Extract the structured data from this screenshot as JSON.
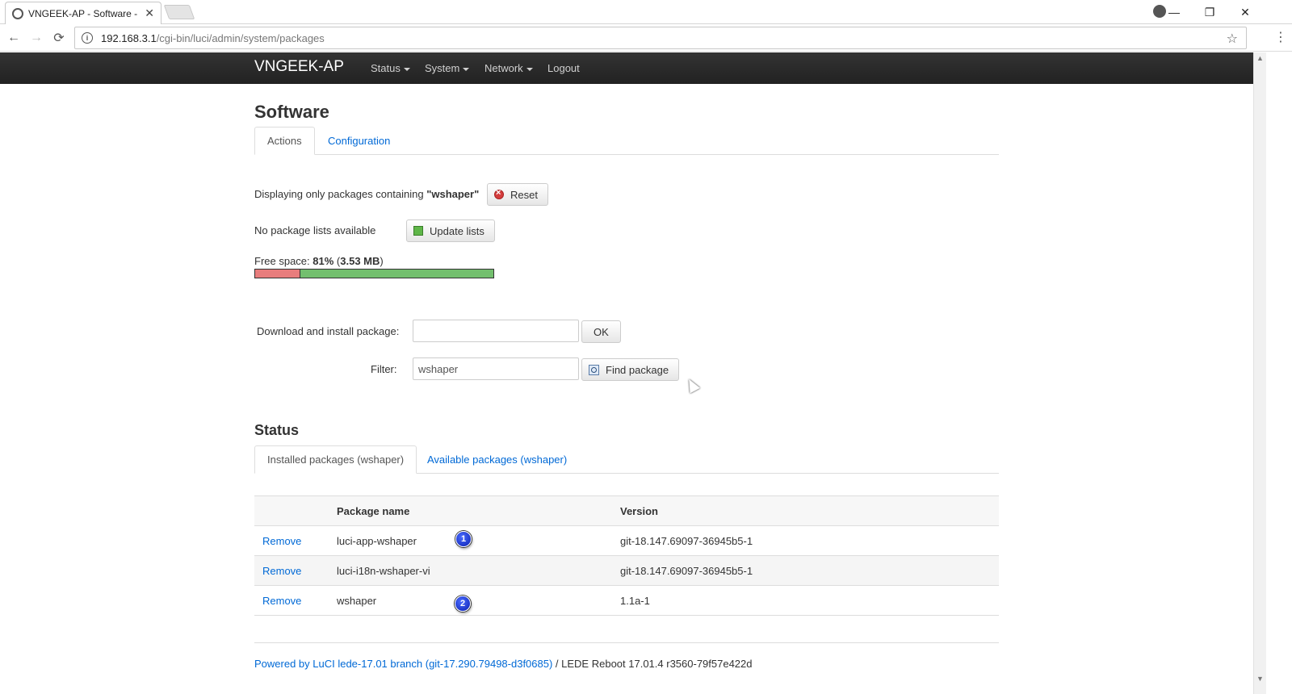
{
  "browser": {
    "tab_title": "VNGEEK-AP - Software -",
    "tab_close": "✕",
    "url_host": "192.168.3.1",
    "url_path": "/cgi-bin/luci/admin/system/packages",
    "back": "←",
    "forward": "→",
    "reload": "⟳",
    "star": "☆",
    "menu": "⋮",
    "minimize": "—",
    "restore": "❐",
    "close": "✕"
  },
  "navbar": {
    "brand": "VNGEEK-AP",
    "items": [
      "Status",
      "System",
      "Network",
      "Logout"
    ]
  },
  "page": {
    "title": "Software",
    "tabs": [
      "Actions",
      "Configuration"
    ],
    "filter_notice_prefix": "Displaying only packages containing ",
    "filter_notice_term": "\"wshaper\"",
    "reset_label": "Reset",
    "no_lists_text": "No package lists available",
    "update_lists_label": "Update lists",
    "free_space_prefix": "Free space: ",
    "free_space_pct": "81%",
    "free_space_size": "3.53 MB",
    "used_fraction": 0.19,
    "download_label": "Download and install package:",
    "download_value": "",
    "ok_label": "OK",
    "filter_label": "Filter:",
    "filter_value": "wshaper",
    "find_label": "Find package"
  },
  "status": {
    "title": "Status",
    "tabs": [
      "Installed packages (wshaper)",
      "Available packages (wshaper)"
    ],
    "columns": [
      "",
      "Package name",
      "Version"
    ],
    "rows": [
      {
        "action": "Remove",
        "name": "luci-app-wshaper",
        "version": "git-18.147.69097-36945b5-1"
      },
      {
        "action": "Remove",
        "name": "luci-i18n-wshaper-vi",
        "version": "git-18.147.69097-36945b5-1"
      },
      {
        "action": "Remove",
        "name": "wshaper",
        "version": "1.1a-1"
      }
    ],
    "badges": [
      "1",
      "2"
    ]
  },
  "footer": {
    "link_text": "Powered by LuCI lede-17.01 branch (git-17.290.79498-d3f0685)",
    "rest_text": " / LEDE Reboot 17.01.4 r3560-79f57e422d"
  },
  "colors": {
    "navbar": "#222222",
    "link": "#0069d6",
    "used_space": "#e87d7d",
    "free_space": "#73bf6e"
  }
}
